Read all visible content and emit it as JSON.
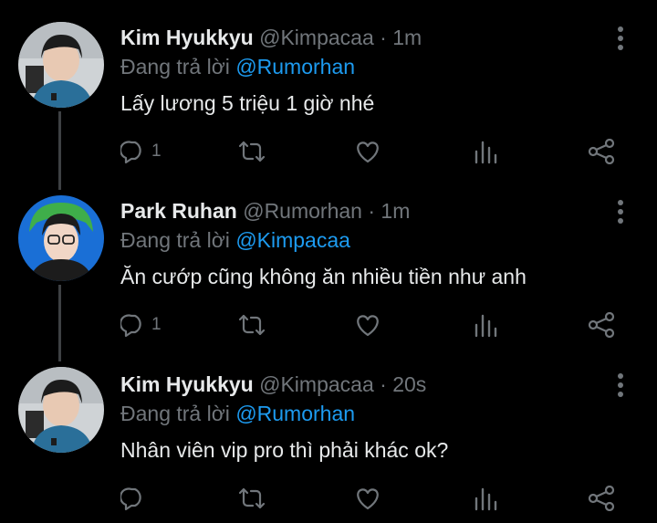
{
  "tweets": [
    {
      "name": "Kim Hyukkyu",
      "handle": "@Kimpacaa",
      "separator": "·",
      "time": "1m",
      "replying_prefix": "Đang trả lời",
      "replying_to": "@Rumorhan",
      "text": "Lấy lương 5 triệu 1 giờ nhé",
      "reply_count": "1"
    },
    {
      "name": "Park Ruhan",
      "handle": "@Rumorhan",
      "separator": "·",
      "time": "1m",
      "replying_prefix": "Đang trả lời",
      "replying_to": "@Kimpacaa",
      "text": "Ăn cướp cũng không ăn nhiều tiền như anh",
      "reply_count": "1"
    },
    {
      "name": "Kim Hyukkyu",
      "handle": "@Kimpacaa",
      "separator": "·",
      "time": "20s",
      "replying_prefix": "Đang trả lời",
      "replying_to": "@Rumorhan",
      "text": "Nhân viên vip pro thì phải khác ok?",
      "reply_count": ""
    }
  ],
  "icons": {
    "reply": "reply-icon",
    "retweet": "retweet-icon",
    "like": "heart-icon",
    "analytics": "analytics-icon",
    "share": "share-icon",
    "more": "more-vertical-icon"
  },
  "colors": {
    "background": "#000000",
    "text": "#e7e9ea",
    "muted": "#71767b",
    "link": "#1d9bf0",
    "thread_line": "#3e4144"
  }
}
